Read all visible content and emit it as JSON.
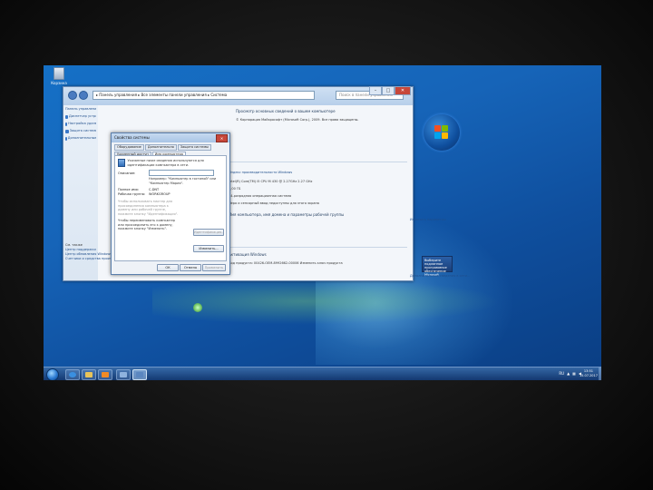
{
  "desktop": {
    "recycle_bin_label": "Корзина"
  },
  "control_panel": {
    "address": "▸ Панель управления ▸ Все элементы панели управления ▸ Система",
    "search_placeholder": "Поиск в панели управления",
    "window_controls": [
      "–",
      "□",
      "✕"
    ],
    "sidebar_links": [
      "Панель управления — домашняя страница",
      "Диспетчер устройств",
      "Настройка удаленного доступа",
      "Защита системы",
      "Дополнительные параметры системы"
    ],
    "see_also_title": "См. также",
    "see_also_links": [
      "Центр поддержки",
      "Центр обновления Windows",
      "Счетчики и средства производительности"
    ],
    "main_title": "Просмотр основных сведений о вашем компьютере",
    "edition_line": "© Корпорация Майкрософт (Microsoft Corp.), 2009. Все права защищены.",
    "rating_line": "Индекс производительности Windows",
    "processor_line": "Intel(R) Core(TM) i5 CPU   M 430  @ 2.27GHz   2.27 GHz",
    "ram_line": "1,00 ГБ",
    "system_type_line": "64-разрядная операционная система",
    "pen_line": "Перо и сенсорный ввод недоступны для этого экрана",
    "domain_title": "Имя компьютера, имя домена и параметры рабочей группы",
    "change_settings": "Изменить параметры",
    "activation_title": "Активация Windows",
    "product_key_line": "Код продукта: 00426-OEM-8992662-00006   Изменить ключ продукта",
    "genuine_badge": "Выберите подлинное программное обеспечение Microsoft",
    "genuine_more": "Дополнительные сведения в сети..."
  },
  "system_dialog": {
    "title": "Свойства системы",
    "close": "✕",
    "tabs": [
      "Оборудование",
      "Дополнительно",
      "Защита системы",
      "Удаленный доступ",
      "Имя компьютера"
    ],
    "active_tab": "Имя компьютера",
    "intro": "Указанные ниже сведения используются для идентификации компьютера в сети.",
    "description_label": "Описание:",
    "description_example": "Например: \"Компьютер в гостиной\" или \"Компьютер Мария\".",
    "fullname_label": "Полное имя:",
    "fullname_value": "C-DNT",
    "workgroup_label": "Рабочая группа:",
    "workgroup_value": "WORKGROUP",
    "network_id_text": "Чтобы использовать мастер для присоединения компьютера к домену или рабочей группе, нажмите кнопку \"Идентификация\".",
    "network_id_button": "Идентификация...",
    "rename_text": "Чтобы переименовать компьютер или присоединить его к домену, нажмите кнопку \"Изменить\".",
    "change_button": "Изменить...",
    "ok_button": "ОК",
    "cancel_button": "Отмена",
    "apply_button": "Применить"
  },
  "taskbar": {
    "tray_lang": "RU",
    "clock_time": "13:51",
    "clock_date": "15.07.2017"
  },
  "colors": {
    "desktop_blue": "#1664b8",
    "close_red": "#c7473a",
    "link_blue": "#1f4e8c"
  }
}
